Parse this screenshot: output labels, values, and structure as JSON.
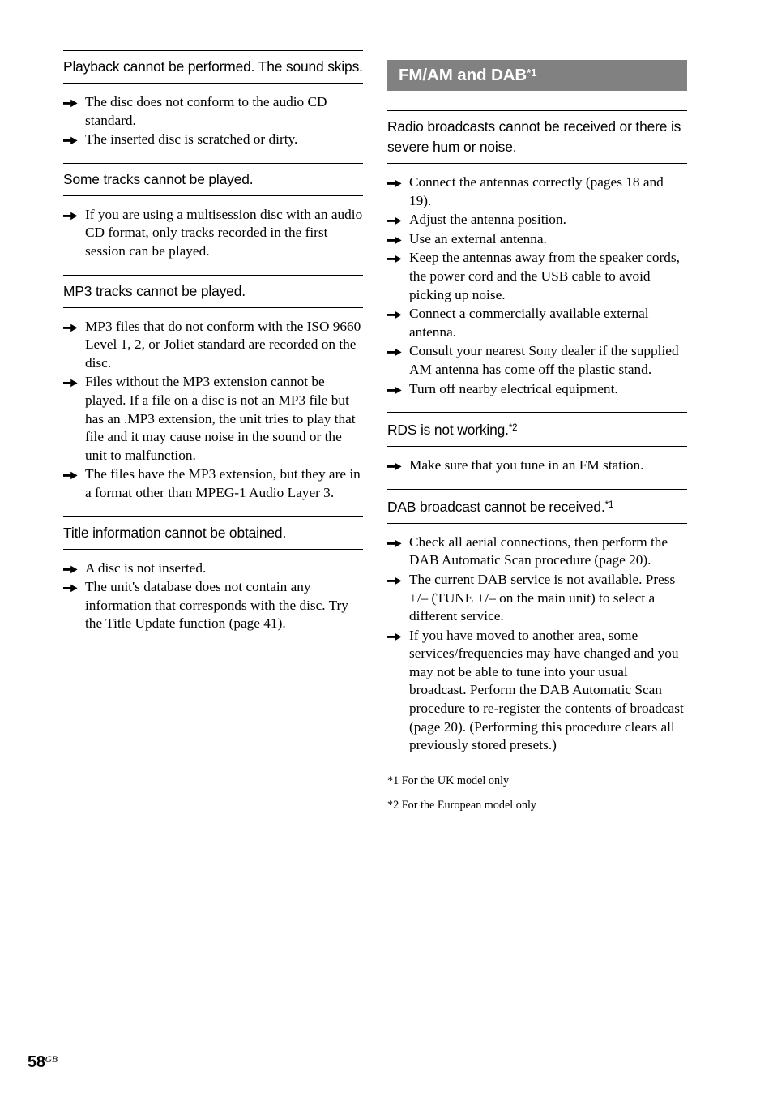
{
  "page": {
    "number": "58",
    "region_code": "GB"
  },
  "banner": {
    "title": "FM/AM and DAB",
    "title_superscript": "*1",
    "background_color": "#818181",
    "text_color": "#ffffff"
  },
  "left_column": {
    "sections": [
      {
        "heading": "Playback cannot be performed. The sound skips.",
        "bullets": [
          "The disc does not conform to the audio CD standard.",
          "The inserted disc is scratched or dirty."
        ]
      },
      {
        "heading": "Some tracks cannot be played.",
        "bullets": [
          "If you are using a multisession disc with an audio CD format, only tracks recorded in the first session can be played."
        ]
      },
      {
        "heading": "MP3 tracks cannot be played.",
        "bullets": [
          "MP3 files that do not conform with the ISO 9660 Level 1, 2, or Joliet standard are recorded on the disc.",
          "Files without the MP3 extension cannot be played. If a file on a disc is not an MP3 file but has an .MP3 extension, the unit tries to play that file and it may cause noise in the sound or the unit to malfunction.",
          "The files have the MP3 extension, but they are in a format other than MPEG-1 Audio Layer 3."
        ]
      },
      {
        "heading": "Title information cannot be obtained.",
        "bullets": [
          "A disc is not inserted.",
          "The unit's database does not contain any information that corresponds with the disc. Try the Title Update function (page 41)."
        ]
      }
    ]
  },
  "right_column": {
    "sections": [
      {
        "heading": "Radio broadcasts cannot be received or there is severe hum or noise.",
        "heading_superscript": "",
        "bullets": [
          "Connect the antennas correctly (pages 18 and 19).",
          "Adjust the antenna position.",
          "Use an external antenna.",
          "Keep the antennas away from the speaker cords, the power cord and the USB cable to avoid picking up noise.",
          "Connect a commercially available external antenna.",
          "Consult your nearest Sony dealer if the supplied AM antenna has come off the plastic stand.",
          "Turn off nearby electrical equipment."
        ]
      },
      {
        "heading": "RDS is not working.",
        "heading_superscript": "*2",
        "bullets": [
          "Make sure that you tune in an FM station."
        ]
      },
      {
        "heading": "DAB broadcast cannot be received.",
        "heading_superscript": "*1",
        "bullets": [
          "Check all aerial connections, then perform the DAB Automatic Scan procedure (page 20).",
          "The current DAB service is not available. Press +/– (TUNE +/– on the main unit) to select a different service.",
          "If you have moved to another area, some services/frequencies may have changed and you may not be able to tune into your usual broadcast. Perform the DAB Automatic Scan procedure to re-register the contents of broadcast (page 20). (Performing this procedure clears all previously stored presets.)"
        ]
      }
    ],
    "footnotes": [
      "*1 For the UK model only",
      "*2 For the European model only"
    ]
  },
  "icons": {
    "bullet": "arrow-right-icon"
  }
}
